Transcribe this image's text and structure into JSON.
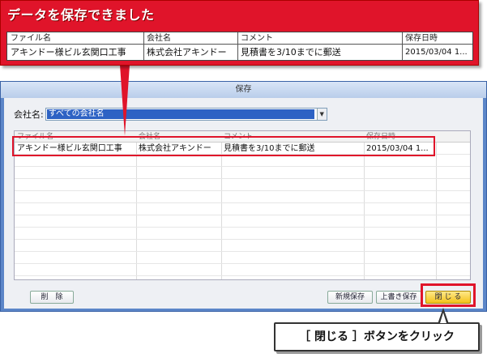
{
  "callout_top": {
    "title": "データを保存できました",
    "columns": [
      "ファイル名",
      "会社名",
      "コメント",
      "保存日時"
    ],
    "row": [
      "アキンドー様ビル玄関口工事",
      "株式会社アキンドー",
      "見積書を3/10までに郵送",
      "2015/03/04 1..."
    ]
  },
  "dialog": {
    "title": "保存",
    "company_label": "会社名:",
    "company_value": "すべての会社名",
    "grid": {
      "columns": [
        "ファイル名",
        "会社名",
        "コメント",
        "保存日時"
      ],
      "rows": [
        [
          "アキンドー様ビル玄関口工事",
          "株式会社アキンドー",
          "見積書を3/10までに郵送",
          "2015/03/04 1..."
        ]
      ]
    },
    "buttons": {
      "delete": "削　除",
      "new_save": "新規保存",
      "overwrite": "上書き保存",
      "close": "閉 じ る"
    }
  },
  "callout_bottom": {
    "text": "［ 閉じる ］ボタンをクリック"
  },
  "colors": {
    "highlight": "#e0142a",
    "dialog_frame": "#5c86c8",
    "selection": "#2d62c4",
    "close_button": "#f3c21a"
  }
}
